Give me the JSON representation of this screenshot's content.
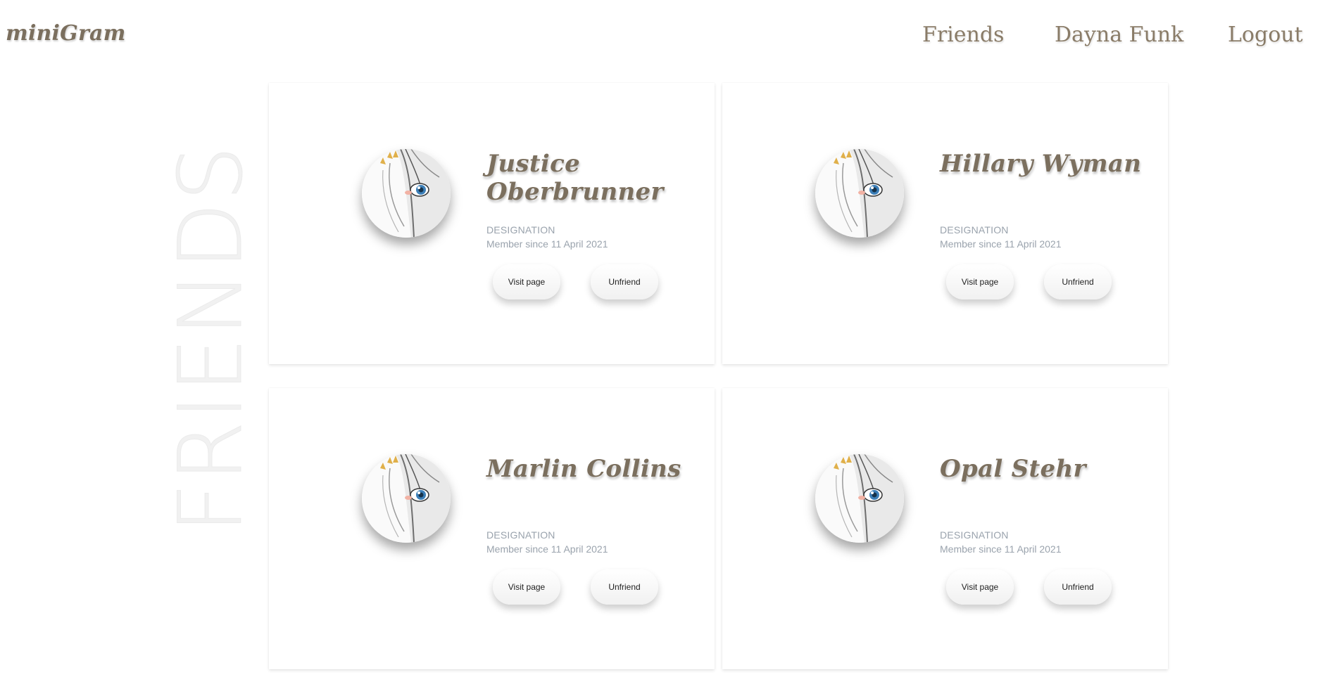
{
  "brand": "miniGram",
  "nav": {
    "friends": "Friends",
    "user": "Dayna Funk",
    "logout": "Logout"
  },
  "page_title": "FRIENDS",
  "cards": [
    {
      "name": "Justice Oberbrunner",
      "designation": "DESIGNATION",
      "member_since": "Member since 11 April 2021",
      "visit_label": "Visit page",
      "unfriend_label": "Unfriend"
    },
    {
      "name": "Hillary Wyman",
      "designation": "DESIGNATION",
      "member_since": "Member since 11 April 2021",
      "visit_label": "Visit page",
      "unfriend_label": "Unfriend"
    },
    {
      "name": "Marlin Collins",
      "designation": "DESIGNATION",
      "member_since": "Member since 11 April 2021",
      "visit_label": "Visit page",
      "unfriend_label": "Unfriend"
    },
    {
      "name": "Opal Stehr",
      "designation": "DESIGNATION",
      "member_since": "Member since 11 April 2021",
      "visit_label": "Visit page",
      "unfriend_label": "Unfriend"
    }
  ],
  "colors": {
    "brand": "#7b6f5e",
    "nav_link": "#8a7c68",
    "muted_text": "#9aa3ad",
    "watermark": "#f1f1f1"
  },
  "icons": {
    "avatar": "anime-girl-avatar"
  }
}
